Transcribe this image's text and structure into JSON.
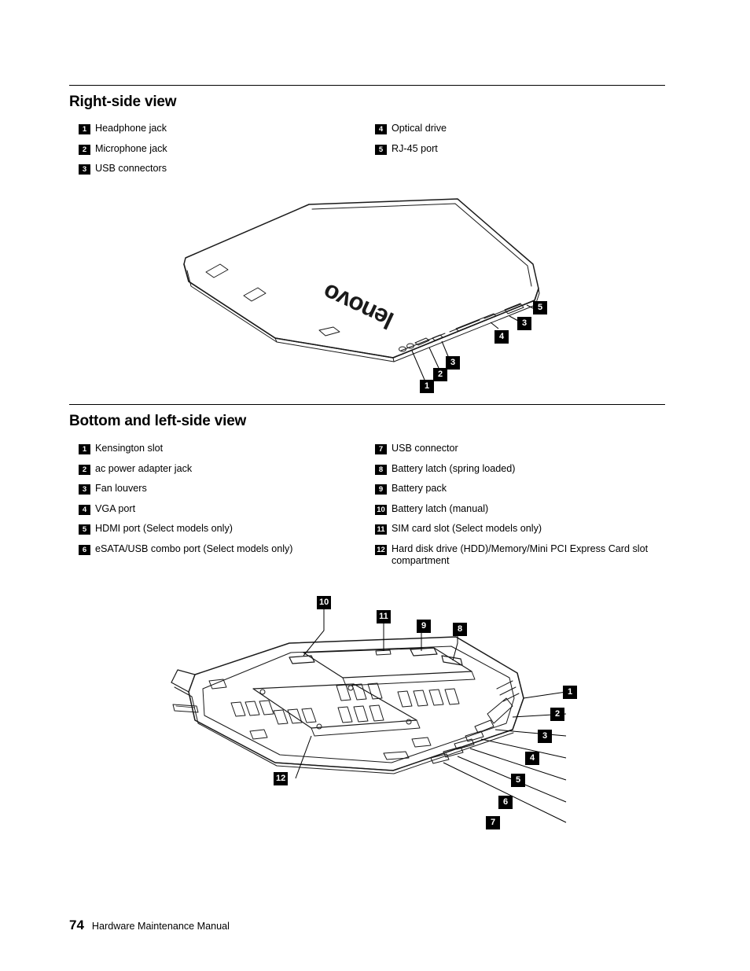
{
  "sections": [
    {
      "title": "Right-side view",
      "legend_left": [
        {
          "num": "1",
          "label": "Headphone jack"
        },
        {
          "num": "2",
          "label": "Microphone jack"
        },
        {
          "num": "3",
          "label": "USB connectors"
        }
      ],
      "legend_right": [
        {
          "num": "4",
          "label": "Optical drive"
        },
        {
          "num": "5",
          "label": "RJ-45 port"
        }
      ],
      "callouts": [
        {
          "num": "5"
        },
        {
          "num": "3"
        },
        {
          "num": "4"
        },
        {
          "num": "3"
        },
        {
          "num": "2"
        },
        {
          "num": "1"
        }
      ],
      "figure_alt": "Closed notebook computer viewed from above showing the Lenovo logo on the lid and right-side ports"
    },
    {
      "title": "Bottom and left-side view",
      "legend_left": [
        {
          "num": "1",
          "label": "Kensington slot"
        },
        {
          "num": "2",
          "label": "ac power adapter jack"
        },
        {
          "num": "3",
          "label": "Fan louvers"
        },
        {
          "num": "4",
          "label": "VGA port"
        },
        {
          "num": "5",
          "label": "HDMI port (Select models only)"
        },
        {
          "num": "6",
          "label": "eSATA/USB combo port (Select models only)"
        }
      ],
      "legend_right": [
        {
          "num": "7",
          "label": "USB connector"
        },
        {
          "num": "8",
          "label": "Battery latch (spring loaded)"
        },
        {
          "num": "9",
          "label": "Battery pack"
        },
        {
          "num": "10",
          "label": "Battery latch (manual)"
        },
        {
          "num": "11",
          "label": "SIM card slot (Select models only)"
        },
        {
          "num": "12",
          "label": "Hard disk drive (HDD)/Memory/Mini PCI Express Card slot compartment"
        }
      ],
      "callouts": [
        {
          "num": "10"
        },
        {
          "num": "11"
        },
        {
          "num": "9"
        },
        {
          "num": "8"
        },
        {
          "num": "1"
        },
        {
          "num": "2"
        },
        {
          "num": "3"
        },
        {
          "num": "4"
        },
        {
          "num": "5"
        },
        {
          "num": "6"
        },
        {
          "num": "7"
        },
        {
          "num": "12"
        }
      ],
      "figure_alt": "Bottom view of the notebook computer showing battery latches, battery pack, vents and left-side ports"
    }
  ],
  "footer": {
    "page_number": "74",
    "title": "Hardware Maintenance Manual"
  }
}
